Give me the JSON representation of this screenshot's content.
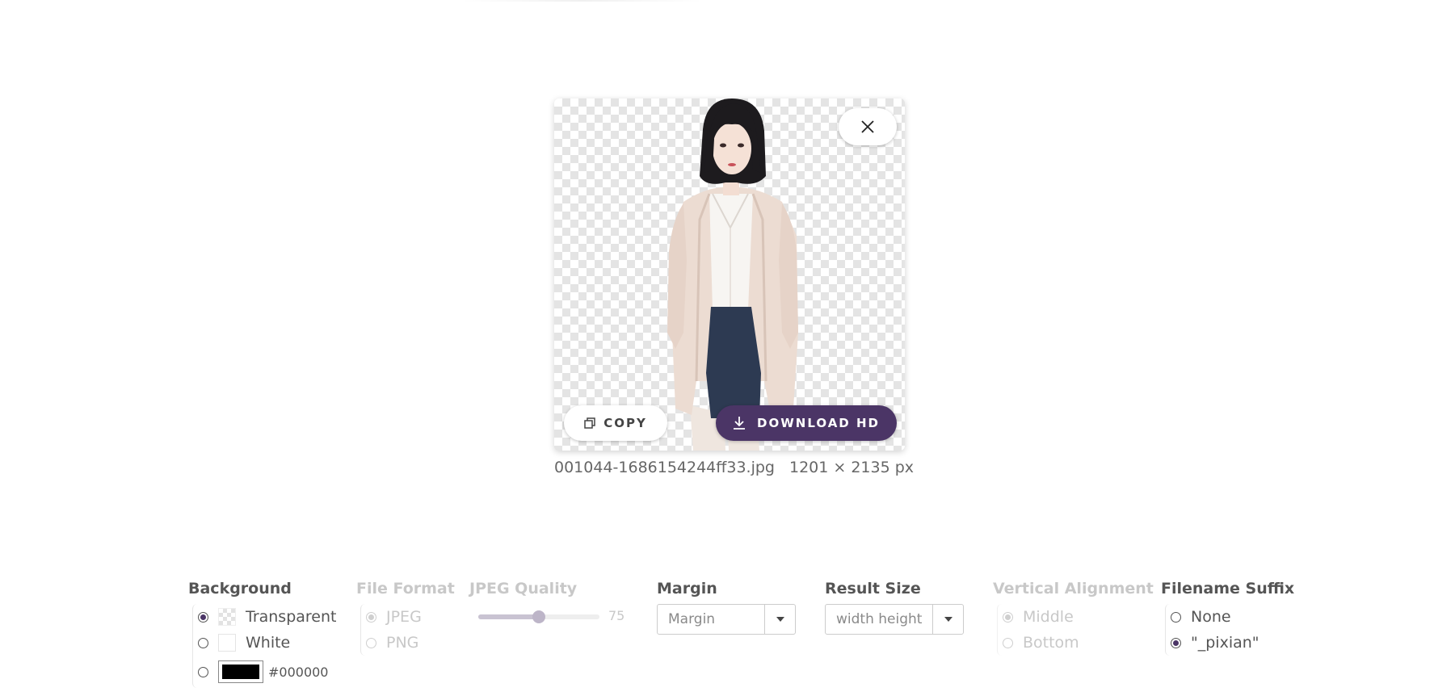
{
  "preview": {
    "copy_label": "COPY",
    "download_label": "DOWNLOAD HD",
    "icons": {
      "close": "close-icon",
      "copy": "copy-icon",
      "download": "download-icon"
    }
  },
  "file": {
    "name": "001044-1686154244ff33.jpg",
    "dimensions": "1201 × 2135 px"
  },
  "options": {
    "background": {
      "label": "Background",
      "options": [
        {
          "label": "Transparent",
          "selected": true
        },
        {
          "label": "White",
          "selected": false
        },
        {
          "label": "",
          "selected": false
        }
      ],
      "custom_color": "#000000"
    },
    "file_format": {
      "label": "File Format",
      "disabled": true,
      "options": [
        {
          "label": "JPEG",
          "selected": true
        },
        {
          "label": "PNG",
          "selected": false
        }
      ]
    },
    "jpeg_quality": {
      "label": "JPEG Quality",
      "disabled": true,
      "value": "75",
      "fraction": 0.5
    },
    "margin": {
      "label": "Margin",
      "value": "Margin"
    },
    "result_size": {
      "label": "Result Size",
      "value": "width height"
    },
    "vertical_alignment": {
      "label": "Vertical Alignment",
      "disabled": true,
      "options": [
        {
          "label": "Middle",
          "selected": true
        },
        {
          "label": "Bottom",
          "selected": false
        }
      ]
    },
    "filename_suffix": {
      "label": "Filename Suffix",
      "options": [
        {
          "label": "None",
          "selected": false
        },
        {
          "label": "\"_pixian\"",
          "selected": true
        }
      ]
    }
  },
  "colors": {
    "accent": "#4b3566",
    "disabled": "#c8c8c8",
    "text": "#555555"
  }
}
